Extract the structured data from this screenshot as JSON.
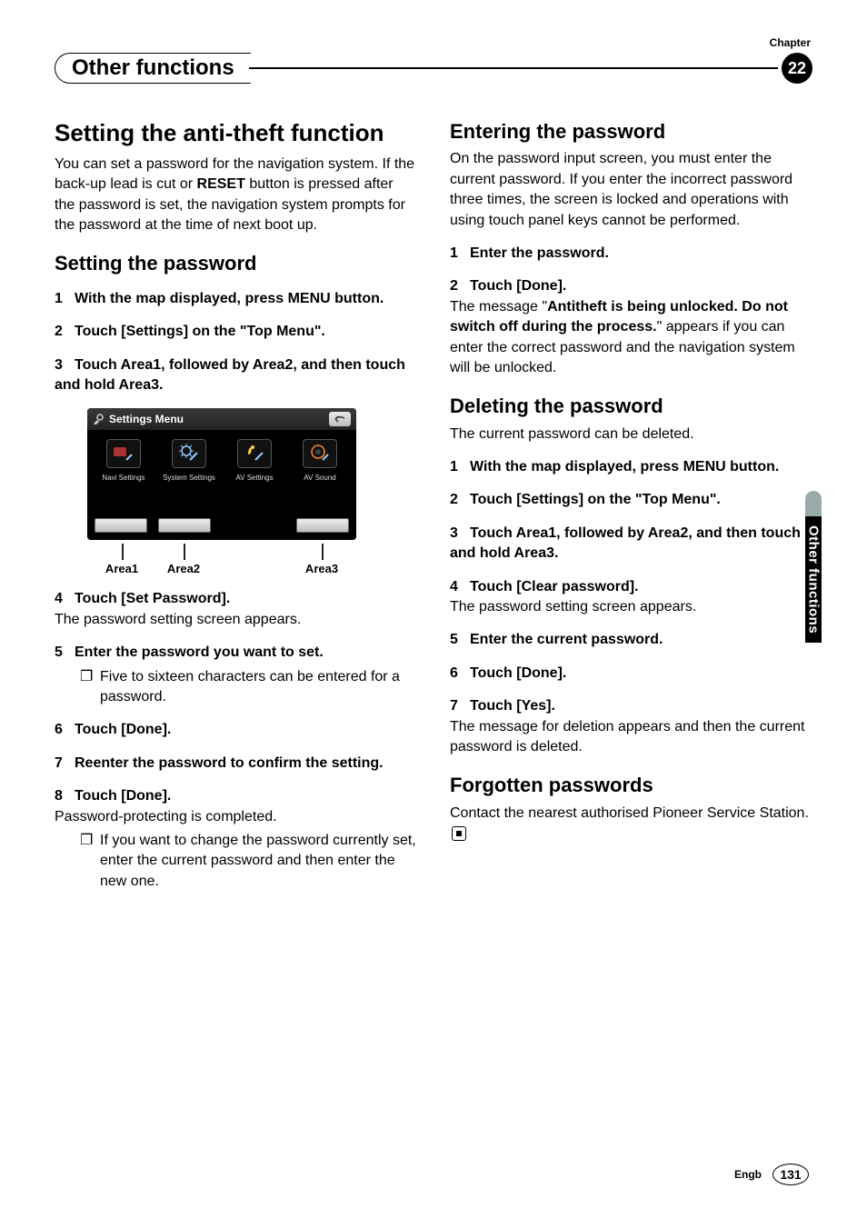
{
  "header": {
    "chapter_label": "Chapter",
    "section_title": "Other functions",
    "chapter_number": "22"
  },
  "side_tab": "Other functions",
  "left": {
    "h1": "Setting the anti-theft function",
    "intro_a": "You can set a password for the navigation system. If the back-up lead is cut or ",
    "intro_reset": "RESET",
    "intro_b": " button is pressed after the password is set, the navigation system prompts for the password at the time of next boot up.",
    "h2a": "Setting the password",
    "s1": "With the map displayed, press MENU button.",
    "s2": "Touch [Settings] on the \"Top Menu\".",
    "s3": "Touch Area1, followed by Area2, and then touch and hold Area3.",
    "sm_title": "Settings Menu",
    "sm_items": [
      "Navi Settings",
      "System Settings",
      "AV Settings",
      "AV Sound"
    ],
    "areas": [
      "Area1",
      "Area2",
      "Area3"
    ],
    "s4": "Touch [Set Password].",
    "s4_after": "The password setting screen appears.",
    "s5": "Enter the password you want to set.",
    "s5_note": "Five to sixteen characters can be entered for a password.",
    "s6": "Touch [Done].",
    "s7": "Reenter the password to confirm the setting.",
    "s8": "Touch [Done].",
    "s8_after": "Password-protecting is completed.",
    "s8_note": "If you want to change the password currently set, enter the current password and then enter the new one."
  },
  "right": {
    "h2a": "Entering the password",
    "p1": "On the password input screen, you must enter the current password. If you enter the incorrect password three times, the screen is locked and operations with using touch panel keys cannot be performed.",
    "e1": "Enter the password.",
    "e2": "Touch [Done].",
    "e2_after_a": "The message \"",
    "e2_bold": "Antitheft is being unlocked. Do not switch off during the process.",
    "e2_after_b": "\" appears if you can enter the correct password and the navigation system will be unlocked.",
    "h2b": "Deleting the password",
    "p2": "The current password can be deleted.",
    "d1": "With the map displayed, press MENU button.",
    "d2": "Touch [Settings] on the \"Top Menu\".",
    "d3": "Touch Area1, followed by Area2, and then touch and hold Area3.",
    "d4": "Touch [Clear password].",
    "d4_after": "The password setting screen appears.",
    "d5": "Enter the current password.",
    "d6": "Touch [Done].",
    "d7": "Touch [Yes].",
    "d7_after": "The message for deletion appears and then the current password is deleted.",
    "h2c": "Forgotten passwords",
    "p3": "Contact the nearest authorised Pioneer Service Station."
  },
  "footer": {
    "lang": "Engb",
    "page": "131"
  }
}
